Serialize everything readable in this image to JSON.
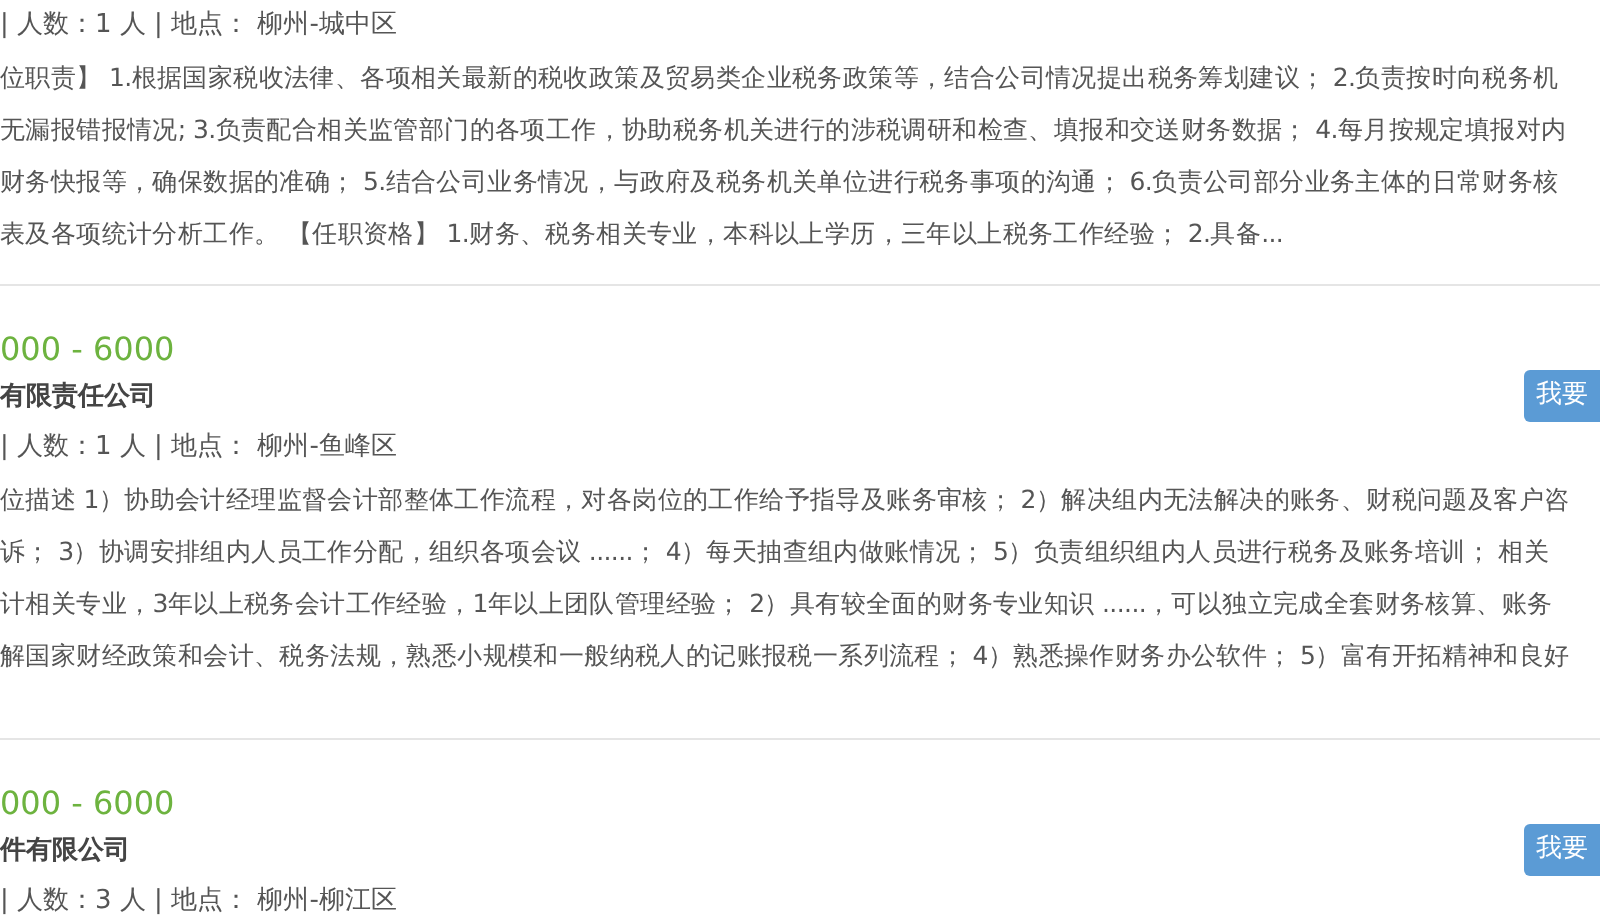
{
  "jobs": [
    {
      "meta": "| 人数：1 人 | 地点：  柳州-城中区",
      "description": [
        "位职责】 1.根据国家税收法律、各项相关最新的税收政策及贸易类企业税务政策等，结合公司情况提出税务筹划建议； 2.负责按时向税务机",
        "无漏报错报情况; 3.负责配合相关监管部门的各项工作，协助税务机关进行的涉税调研和检查、填报和交送财务数据； 4.每月按规定填报对内",
        "财务快报等，确保数据的准确； 5.结合公司业务情况，与政府及税务机关单位进行税务事项的沟通； 6.负责公司部分业务主体的日常财务核",
        "表及各项统计分析工作。 【任职资格】 1.财务、税务相关专业，本科以上学历，三年以上税务工作经验； 2.具备..."
      ]
    },
    {
      "salary": "000 - 6000",
      "company": "有限责任公司",
      "apply_button": "我要",
      "meta": "| 人数：1 人 | 地点：  柳州-鱼峰区",
      "description": [
        "位描述 1）协助会计经理监督会计部整体工作流程，对各岗位的工作给予指导及账务审核； 2）解决组内无法解决的账务、财税问题及客户咨",
        "诉； 3）协调安排组内人员工作分配，组织各项会议 ......； 4）每天抽查组内做账情况； 5）负责组织组内人员进行税务及账务培训； 相关",
        "计相关专业，3年以上税务会计工作经验，1年以上团队管理经验； 2）具有较全面的财务专业知识 ......，可以独立完成全套财务核算、账务",
        "解国家财经政策和会计、税务法规，熟悉小规模和一般纳税人的记账报税一系列流程； 4）熟悉操作财务办公软件； 5）富有开拓精神和良好"
      ]
    },
    {
      "salary": "000 - 6000",
      "company": "件有限公司",
      "apply_button": "我要",
      "meta": "| 人数：3 人 | 地点：  柳州-柳江区"
    }
  ]
}
